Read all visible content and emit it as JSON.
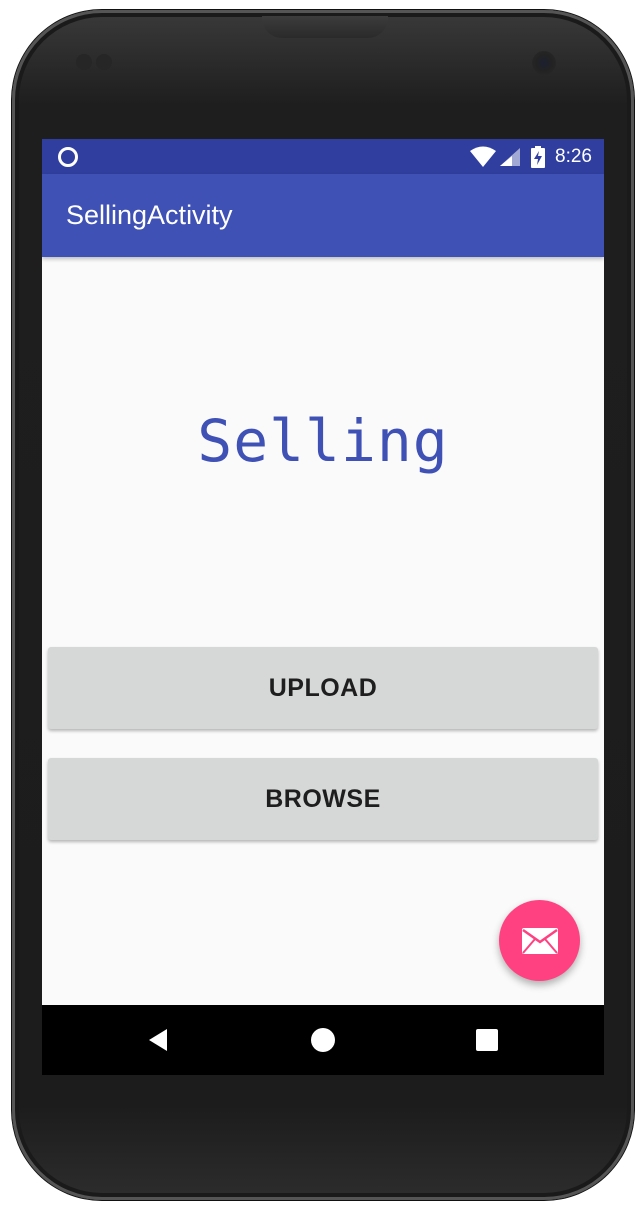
{
  "status_bar": {
    "time": "8:26",
    "icons": [
      "notification-ring-icon",
      "wifi-icon",
      "signal-icon",
      "battery-charging-icon"
    ]
  },
  "app_bar": {
    "title": "SellingActivity"
  },
  "content": {
    "headline": "Selling",
    "buttons": {
      "upload": "UPLOAD",
      "browse": "BROWSE"
    },
    "fab_icon": "email-icon"
  },
  "navigation_bar": {
    "icons": [
      "back-icon",
      "home-icon",
      "recents-icon"
    ]
  },
  "colors": {
    "primary": "#3f51b5",
    "primary_dark": "#303f9f",
    "accent": "#ff4081",
    "button": "#d6d7d7",
    "background": "#fafafa"
  }
}
